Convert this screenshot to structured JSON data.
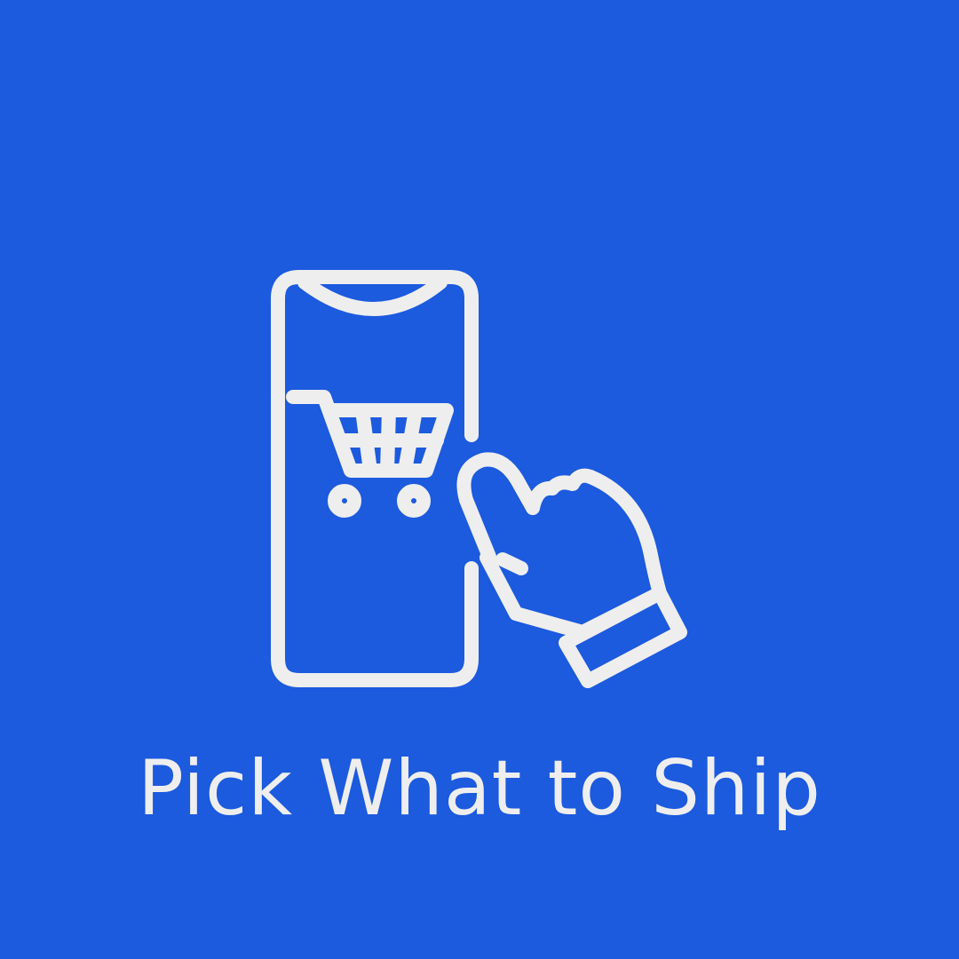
{
  "theme": {
    "background": "#1c5ade",
    "foreground": "#eeeeee"
  },
  "illustration": {
    "icons": [
      "smartphone-icon",
      "shopping-cart-icon",
      "pointing-hand-icon"
    ]
  },
  "caption": {
    "text": "Pick What to Ship"
  }
}
